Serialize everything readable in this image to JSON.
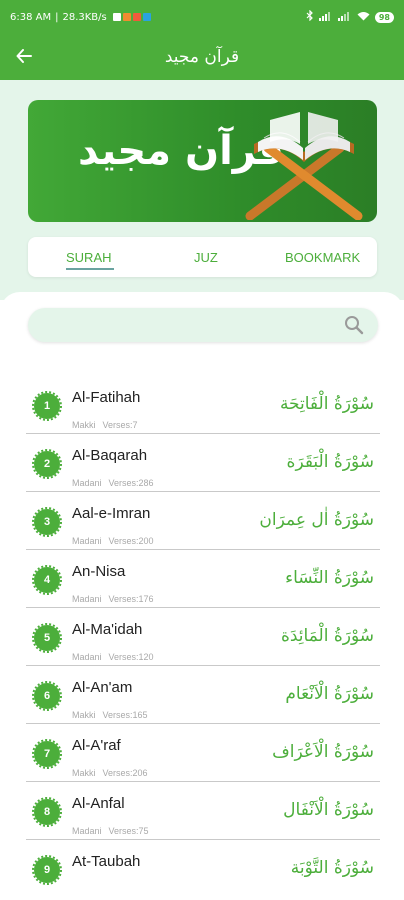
{
  "status_bar": {
    "time": "6:38 AM",
    "network_speed": "28.3KB/s",
    "battery": "98"
  },
  "app_bar": {
    "title": "قرآن مجید",
    "back_icon": "back-arrow-icon"
  },
  "banner": {
    "title": "قرآن مجید",
    "icon": "quran-on-stand-icon"
  },
  "tabs": [
    {
      "label": "SURAH",
      "active": true
    },
    {
      "label": "JUZ",
      "active": false
    },
    {
      "label": "BOOKMARK",
      "active": false
    }
  ],
  "search": {
    "placeholder": "",
    "value": "",
    "icon": "search-icon"
  },
  "surahs": [
    {
      "number": "1",
      "name": "Al-Fatihah",
      "type": "Makki",
      "verses": "Verses:7",
      "arabic": "سُوْرَةُ الْفَاتِحَة"
    },
    {
      "number": "2",
      "name": "Al-Baqarah",
      "type": "Madani",
      "verses": "Verses:286",
      "arabic": "سُوْرَةُ الْبَقَرَة"
    },
    {
      "number": "3",
      "name": "Aal-e-Imran",
      "type": "Madani",
      "verses": "Verses:200",
      "arabic": "سُوْرَةُ اٰل عِمرَان"
    },
    {
      "number": "4",
      "name": "An-Nisa",
      "type": "Madani",
      "verses": "Verses:176",
      "arabic": "سُوْرَةُ النِّسَاء"
    },
    {
      "number": "5",
      "name": "Al-Ma'idah",
      "type": "Madani",
      "verses": "Verses:120",
      "arabic": "سُوْرَةُ الْمَائِدَة"
    },
    {
      "number": "6",
      "name": "Al-An'am",
      "type": "Makki",
      "verses": "Verses:165",
      "arabic": "سُوْرَةُ الْاَنْعَام"
    },
    {
      "number": "7",
      "name": "Al-A'raf",
      "type": "Makki",
      "verses": "Verses:206",
      "arabic": "سُوْرَةُ الْاَعْرَاف"
    },
    {
      "number": "8",
      "name": "Al-Anfal",
      "type": "Madani",
      "verses": "Verses:75",
      "arabic": "سُوْرَةُ الْاَنْفَال"
    },
    {
      "number": "9",
      "name": "At-Taubah",
      "type": "",
      "verses": "",
      "arabic": "سُوْرَةُ التَّوْبَة"
    }
  ],
  "colors": {
    "primary": "#4cae3b",
    "background_tint": "#e4f5ea",
    "badge": "#4cae3b",
    "tab_underline": "#6aa3a0"
  }
}
